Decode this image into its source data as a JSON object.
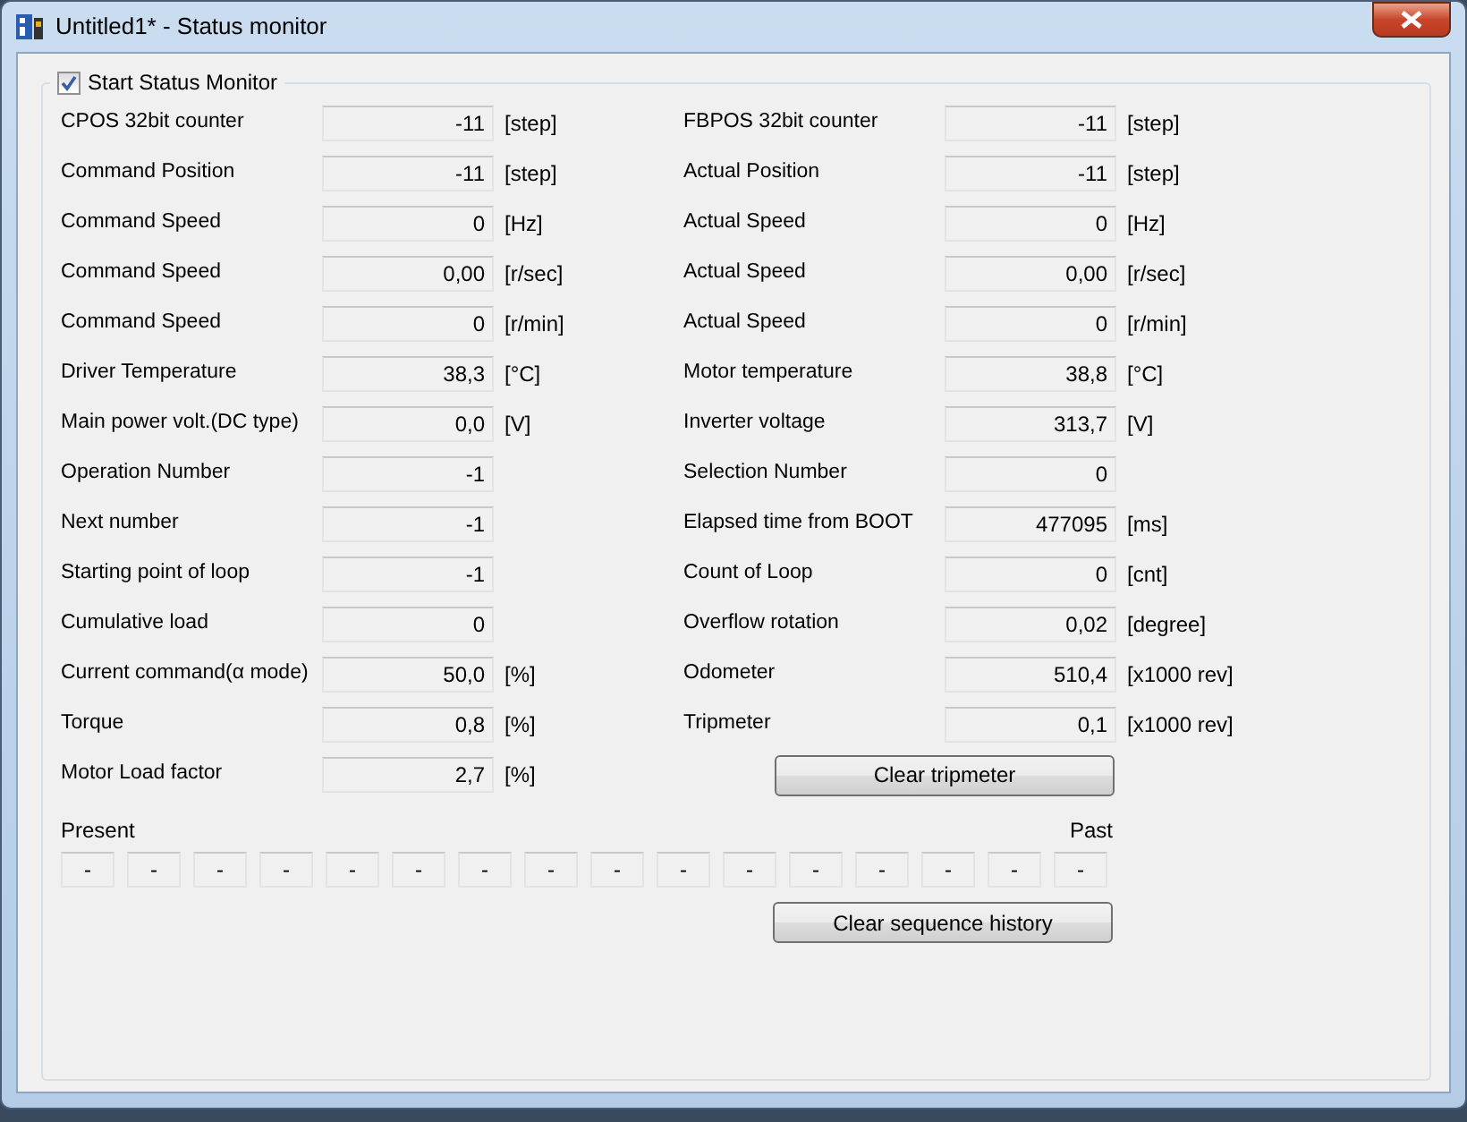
{
  "window": {
    "title": "Untitled1* - Status monitor"
  },
  "monitor": {
    "label": "Start Status Monitor",
    "checked": true
  },
  "left_fields": [
    {
      "label": "CPOS 32bit counter",
      "value": "-11",
      "unit": "[step]"
    },
    {
      "label": "Command Position",
      "value": "-11",
      "unit": "[step]"
    },
    {
      "label": "Command Speed",
      "value": "0",
      "unit": "[Hz]"
    },
    {
      "label": "Command Speed",
      "value": "0,00",
      "unit": "[r/sec]"
    },
    {
      "label": "Command Speed",
      "value": "0",
      "unit": "[r/min]"
    },
    {
      "label": "Driver Temperature",
      "value": "38,3",
      "unit": "[°C]"
    },
    {
      "label": "Main power volt.(DC type)",
      "value": "0,0",
      "unit": "[V]"
    },
    {
      "label": "Operation Number",
      "value": "-1"
    },
    {
      "label": "Next number",
      "value": "-1"
    },
    {
      "label": "Starting point of loop",
      "value": "-1"
    },
    {
      "label": "Cumulative load",
      "value": "0"
    },
    {
      "label": "Current command(α mode)",
      "value": "50,0",
      "unit": "[%]"
    },
    {
      "label": "Torque",
      "value": "0,8",
      "unit": "[%]"
    },
    {
      "label": "Motor Load factor",
      "value": "2,7",
      "unit": "[%]"
    }
  ],
  "right_fields": [
    {
      "label": "FBPOS 32bit counter",
      "value": "-11",
      "unit": "[step]"
    },
    {
      "label": "Actual Position",
      "value": "-11",
      "unit": "[step]"
    },
    {
      "label": "Actual Speed",
      "value": "0",
      "unit": "[Hz]"
    },
    {
      "label": "Actual Speed",
      "value": "0,00",
      "unit": "[r/sec]"
    },
    {
      "label": "Actual Speed",
      "value": "0",
      "unit": "[r/min]"
    },
    {
      "label": "Motor temperature",
      "value": "38,8",
      "unit": "[°C]"
    },
    {
      "label": "Inverter voltage",
      "value": "313,7",
      "unit": "[V]"
    },
    {
      "label": "Selection Number",
      "value": "0"
    },
    {
      "label": "Elapsed time from BOOT",
      "value": "477095",
      "unit": "[ms]"
    },
    {
      "label": "Count of Loop",
      "value": "0",
      "unit": "[cnt]"
    },
    {
      "label": "Overflow rotation",
      "value": "0,02",
      "unit": "[degree]"
    },
    {
      "label": "Odometer",
      "value": "510,4",
      "unit": "[x1000 rev]"
    },
    {
      "label": "Tripmeter",
      "value": "0,1",
      "unit": "[x1000 rev]"
    }
  ],
  "clear_tripmeter_button": "Clear tripmeter",
  "history": {
    "present_label": "Present",
    "past_label": "Past",
    "cells": [
      "-",
      "-",
      "-",
      "-",
      "-",
      "-",
      "-",
      "-",
      "-",
      "-",
      "-",
      "-",
      "-",
      "-",
      "-",
      "-"
    ]
  },
  "clear_history_button": "Clear sequence history"
}
